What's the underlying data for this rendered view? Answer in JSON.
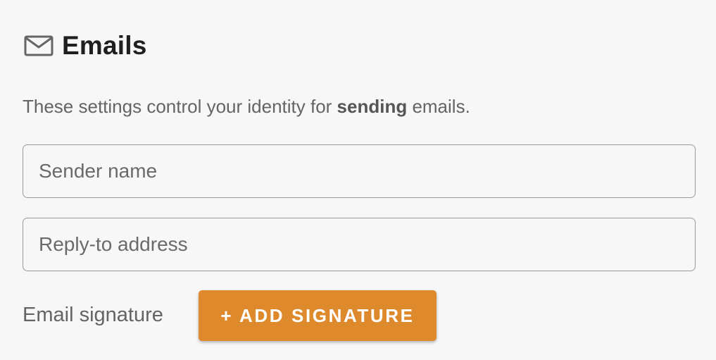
{
  "header": {
    "icon": "mail-icon",
    "title": "Emails"
  },
  "description": {
    "prefix": "These settings control your identity for ",
    "emphasis": "sending",
    "suffix": " emails."
  },
  "fields": {
    "sender_name": {
      "placeholder": "Sender name",
      "value": ""
    },
    "reply_to": {
      "placeholder": "Reply-to address",
      "value": ""
    }
  },
  "signature": {
    "label": "Email signature",
    "button_label": "+ ADD SIGNATURE"
  },
  "colors": {
    "accent": "#de8a2c",
    "background": "#f7f7f7",
    "border": "#9a9a9a"
  }
}
